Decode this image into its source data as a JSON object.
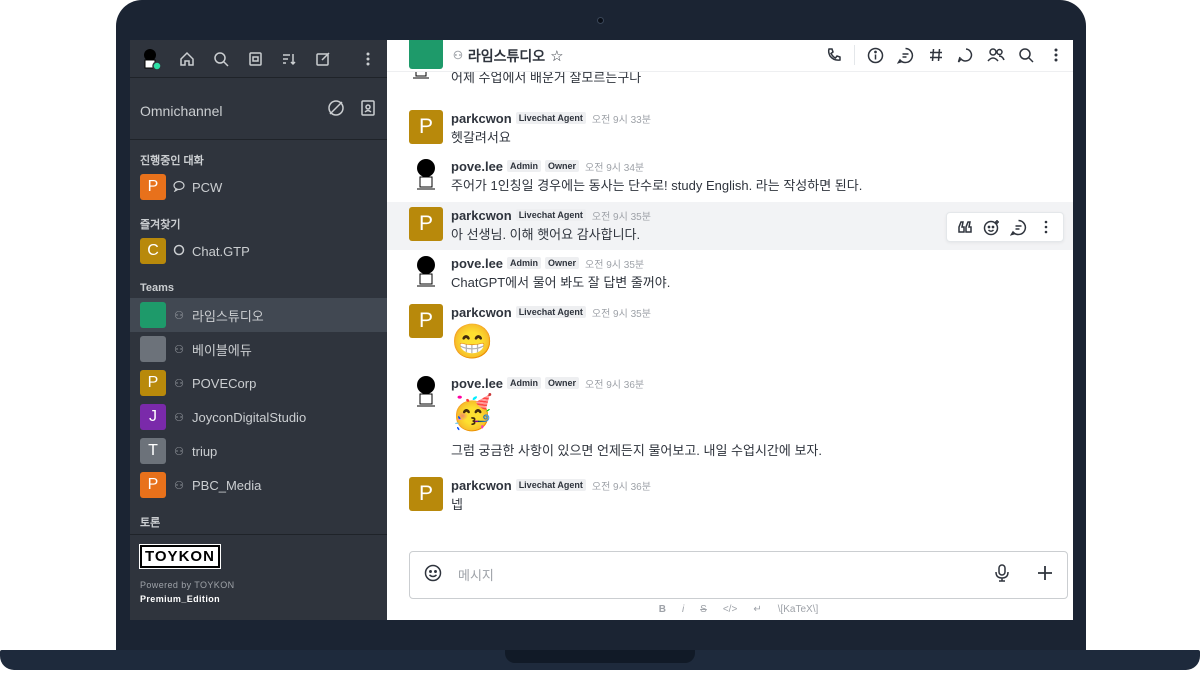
{
  "sidebar": {
    "omnichannel_title": "Omnichannel",
    "sections": {
      "in_progress": "진행중인 대화",
      "favorites": "즐겨찾기",
      "teams": "Teams",
      "discussion": "토론"
    },
    "in_progress_items": [
      {
        "initial": "P",
        "label": "PCW",
        "color": "#e8711b",
        "kind": "livechat-icon"
      }
    ],
    "favorite_items": [
      {
        "initial": "C",
        "label": "Chat.GTP",
        "color": "#b8890b",
        "kind": "circle-icon"
      }
    ],
    "team_items": [
      {
        "initial": "",
        "label": "라임스튜디오",
        "color": "#1e9a6a",
        "kind": "team-icon"
      },
      {
        "initial": "",
        "label": "베이블에듀",
        "color": "#6c727a",
        "kind": "team-icon"
      },
      {
        "initial": "P",
        "label": "POVECorp",
        "color": "#b8890b",
        "kind": "team-icon"
      },
      {
        "initial": "J",
        "label": "JoyconDigitalStudio",
        "color": "#7a2aaa",
        "kind": "team-icon"
      },
      {
        "initial": "T",
        "label": "triup",
        "color": "#6c727a",
        "kind": "team-icon"
      },
      {
        "initial": "P",
        "label": "PBC_Media",
        "color": "#e8711b",
        "kind": "team-icon"
      }
    ],
    "footer": {
      "brand": "TOYKON",
      "powered": "Powered by TOYKON",
      "edition": "Premium_Edition"
    }
  },
  "header": {
    "room_name": "라임스튜디오"
  },
  "messages": [
    {
      "text": "어제 수업에서 배운거 잘모르는구나"
    },
    {
      "user": "parkcwon",
      "tags": [
        "Livechat Agent"
      ],
      "time": "오전 9시 33분",
      "text": "헷갈려서요",
      "initial": "P"
    },
    {
      "user": "pove.lee",
      "tags": [
        "Admin",
        "Owner"
      ],
      "time": "오전 9시 34분",
      "text": "주어가 1인칭일 경우에는 동사는 단수로! study English. 라는 작성하면 된다."
    },
    {
      "user": "parkcwon",
      "tags": [
        "Livechat Agent"
      ],
      "time": "오전 9시 35분",
      "text": "아 선생님. 이해 햇어요 감사합니다.",
      "initial": "P"
    },
    {
      "user": "pove.lee",
      "tags": [
        "Admin",
        "Owner"
      ],
      "time": "오전 9시 35분",
      "text": "ChatGPT에서 물어 봐도 잘 답변 줄꺼야."
    },
    {
      "user": "parkcwon",
      "tags": [
        "Livechat Agent"
      ],
      "time": "오전 9시 35분",
      "emoji": "😁",
      "initial": "P"
    },
    {
      "user": "pove.lee",
      "tags": [
        "Admin",
        "Owner"
      ],
      "time": "오전 9시 36분",
      "emoji": "🥳",
      "text": "그럼 궁금한 사항이 있으면 언제든지 물어보고. 내일 수업시간에 보자."
    },
    {
      "user": "parkcwon",
      "tags": [
        "Livechat Agent"
      ],
      "time": "오전 9시 36분",
      "text": "넵",
      "initial": "P"
    }
  ],
  "composer": {
    "placeholder": "메시지",
    "format_items": [
      "B",
      "i",
      "S",
      "</>",
      "↵",
      "\\[KaTeX\\]"
    ]
  }
}
